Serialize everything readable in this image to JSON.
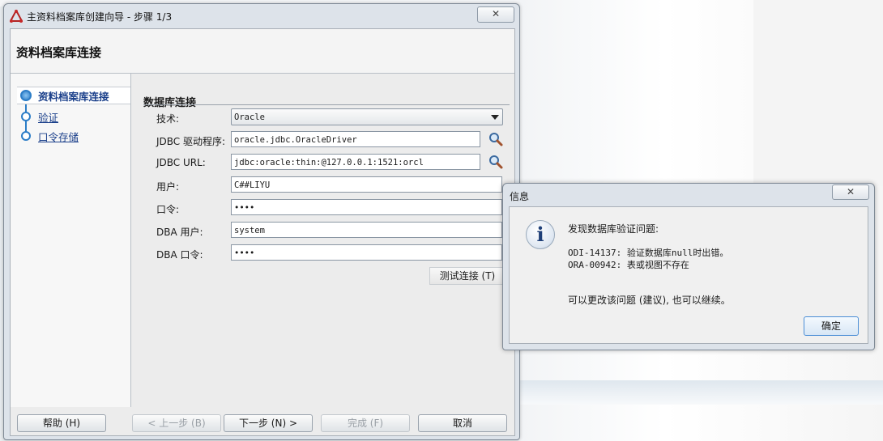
{
  "wizard": {
    "title": "主资料档案库创建向导 - 步骤 1/3",
    "close_label": "✕",
    "page_title": "资料档案库连接",
    "steps": [
      {
        "label": "资料档案库连接"
      },
      {
        "label": "验证"
      },
      {
        "label": "口令存储"
      }
    ],
    "section_title": "数据库连接",
    "fields": {
      "technology": {
        "label": "技术:",
        "value": "Oracle"
      },
      "jdbc_driver": {
        "label": "JDBC 驱动程序:",
        "value": "oracle.jdbc.OracleDriver"
      },
      "jdbc_url": {
        "label": "JDBC URL:",
        "value": "jdbc:oracle:thin:@127.0.0.1:1521:orcl"
      },
      "user": {
        "label": "用户:",
        "value": "C##LIYU"
      },
      "password": {
        "label": "口令:",
        "value": "••••"
      },
      "dba_user": {
        "label": "DBA 用户:",
        "value": "system"
      },
      "dba_password": {
        "label": "DBA 口令:",
        "value": "••••"
      }
    },
    "test_connection": "测试连接 (T)",
    "buttons": {
      "help": "帮助 (H)",
      "back": "< 上一步 (B)",
      "next": "下一步 (N) >",
      "finish": "完成 (F)",
      "cancel": "取消"
    }
  },
  "dialog": {
    "title": "信息",
    "close_label": "✕",
    "icon_glyph": "i",
    "heading": "发现数据库验证问题:",
    "line1": "ODI-14137: 验证数据库null时出错。",
    "line2": "ORA-00942: 表或视图不存在",
    "footer": "可以更改该问题 (建议), 也可以继续。",
    "ok": "确定"
  }
}
